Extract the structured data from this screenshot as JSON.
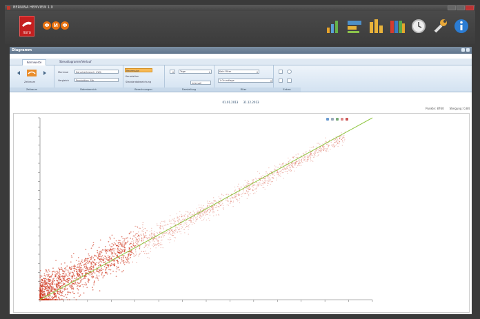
{
  "window": {
    "title": "BERNINA HEMVIEW 1.0"
  },
  "app": {
    "logo_text": "ЛОГО",
    "badges": [
      "Ф",
      "И",
      "Ф"
    ],
    "toolbar_icons": [
      "bar-chart-icon",
      "dashboard-icon",
      "bars-icon",
      "binders-icon",
      "clock-icon",
      "wrench-icon",
      "info-icon"
    ]
  },
  "panel": {
    "title": "Diagramm"
  },
  "tabs": [
    {
      "label": "Kennwerte"
    },
    {
      "label": "Streudiagramm/Verlauf"
    }
  ],
  "ribbon": {
    "groups": [
      "Zeitraum",
      "Datenbereich",
      "Berechnungen",
      "Darstellung",
      "Filter",
      "Extras"
    ],
    "nav_label": "Zeitraum",
    "field1_label": "Merkmal",
    "field1_value": "Kanalverbrauch_kWh",
    "field2_label": "Vergleich",
    "field2_value": "Produktion_Stk",
    "calc_button": "Regression",
    "calc_item1": "Korrelation",
    "calc_item2": "Standardabweichung",
    "select1": "Tage",
    "select2": "Intervall",
    "select3": "Kein Filter",
    "select4": "1 Grundlage",
    "select5": "1"
  },
  "dates": {
    "from": "01.01.2013",
    "to": "31.12.2013"
  },
  "info": {
    "left": "Punkte: 8760",
    "right": "Steigung: 0,84"
  },
  "chart_data": {
    "type": "scatter",
    "series": [
      {
        "kind": "points",
        "color": "#cc2a10",
        "note": "dense red scatter cloud"
      },
      {
        "kind": "regression-line",
        "color": "#8ec63f"
      }
    ],
    "xlim": [
      0,
      100
    ],
    "ylim": [
      0,
      100
    ],
    "regression": {
      "x": [
        0,
        100
      ],
      "y": [
        0,
        100
      ]
    },
    "xticks": [],
    "yticks": [],
    "grid": false
  },
  "colors": {
    "scatter": "#cc2a10",
    "regression": "#8ec63f",
    "accent": "#e8710f"
  }
}
